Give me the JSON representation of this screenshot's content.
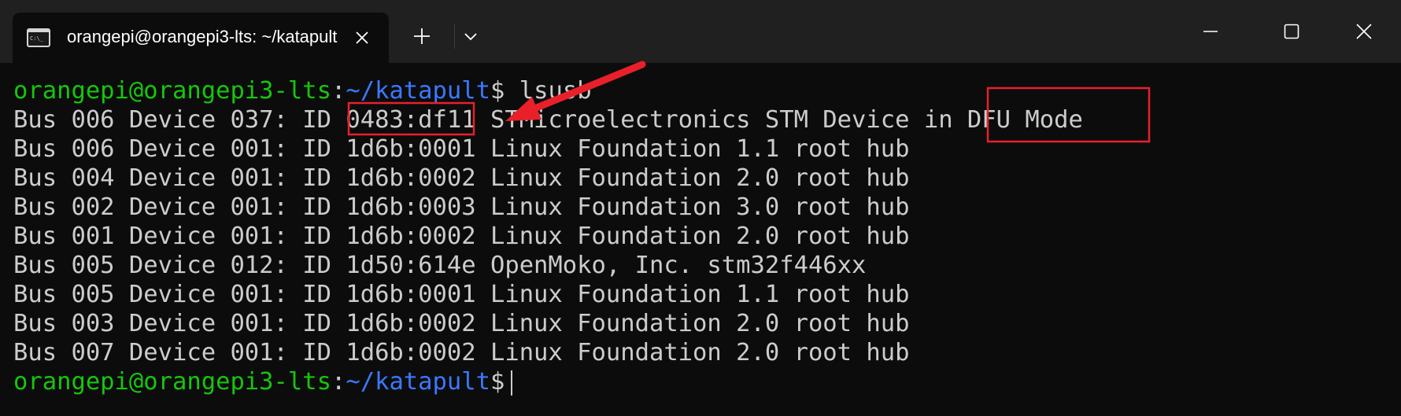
{
  "window": {
    "tab_title": "orangepi@orangepi3-lts: ~/katapult",
    "tab_icon": "terminal-icon",
    "new_tab_icon": "plus-icon",
    "dropdown_icon": "chevron-down-icon",
    "minimize_icon": "minimize-icon",
    "maximize_icon": "maximize-icon",
    "close_icon": "close-icon"
  },
  "terminal": {
    "prompt_user": "orangepi@orangepi3-lts",
    "prompt_colon": ":",
    "prompt_path": "~/katapult",
    "prompt_dollar": "$",
    "command": " lsusb",
    "output": [
      "Bus 006 Device 037: ID 0483:df11 STMicroelectronics STM Device in DFU Mode",
      "Bus 006 Device 001: ID 1d6b:0001 Linux Foundation 1.1 root hub",
      "Bus 004 Device 001: ID 1d6b:0002 Linux Foundation 2.0 root hub",
      "Bus 002 Device 001: ID 1d6b:0003 Linux Foundation 3.0 root hub",
      "Bus 001 Device 001: ID 1d6b:0002 Linux Foundation 2.0 root hub",
      "Bus 005 Device 012: ID 1d50:614e OpenMoko, Inc. stm32f446xx",
      "Bus 005 Device 001: ID 1d6b:0001 Linux Foundation 1.1 root hub",
      "Bus 003 Device 001: ID 1d6b:0002 Linux Foundation 2.0 root hub",
      "Bus 007 Device 001: ID 1d6b:0002 Linux Foundation 2.0 root hub"
    ]
  },
  "annotations": {
    "highlight_color": "#e8202a",
    "highlight_1_text": "0483:df11",
    "highlight_2_text": "DFU Mode"
  },
  "colors": {
    "prompt_user": "#16c60c",
    "prompt_path": "#3b78ff",
    "text": "#cccccc",
    "background": "#0c0c0c",
    "titlebar": "#202020"
  }
}
